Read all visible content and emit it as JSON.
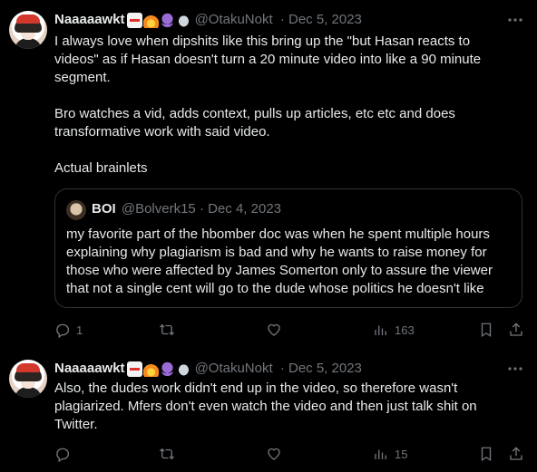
{
  "tweets": [
    {
      "author": "Naaaaawkt",
      "emojis": [
        "ambulance-emoji",
        "fire-emoji",
        "octopus-emoji",
        "dove-emoji"
      ],
      "handle": "@OtakuNokt",
      "sep": "·",
      "date": "Dec 5, 2023",
      "text": "I always love when dipshits like this bring up the \"but Hasan reacts to videos\" as if Hasan doesn't turn a 20 minute video into like a 90 minute segment.\n\nBro watches a vid, adds context, pulls up articles, etc etc and does transformative work with said video.\n\nActual brainlets",
      "quote": {
        "author": "BOI",
        "handle": "@Bolverk15",
        "sep": "·",
        "date": "Dec 4, 2023",
        "text": "my favorite part of the hbomber doc was when he spent multiple hours explaining why plagiarism is bad and why he wants to raise money for those who were affected by James Somerton only to assure the viewer that not a single cent will go to the dude whose politics he doesn't like"
      },
      "stats": {
        "replies": "1",
        "retweets": "",
        "likes": "",
        "views": "163"
      }
    },
    {
      "author": "Naaaaawkt",
      "emojis": [
        "ambulance-emoji",
        "fire-emoji",
        "octopus-emoji",
        "dove-emoji"
      ],
      "handle": "@OtakuNokt",
      "sep": "·",
      "date": "Dec 5, 2023",
      "text": "Also, the dudes work didn't end up in the video, so therefore wasn't plagiarized. Mfers don't even watch the video and then just talk shit on Twitter.",
      "stats": {
        "replies": "",
        "retweets": "",
        "likes": "",
        "views": "15"
      }
    }
  ]
}
